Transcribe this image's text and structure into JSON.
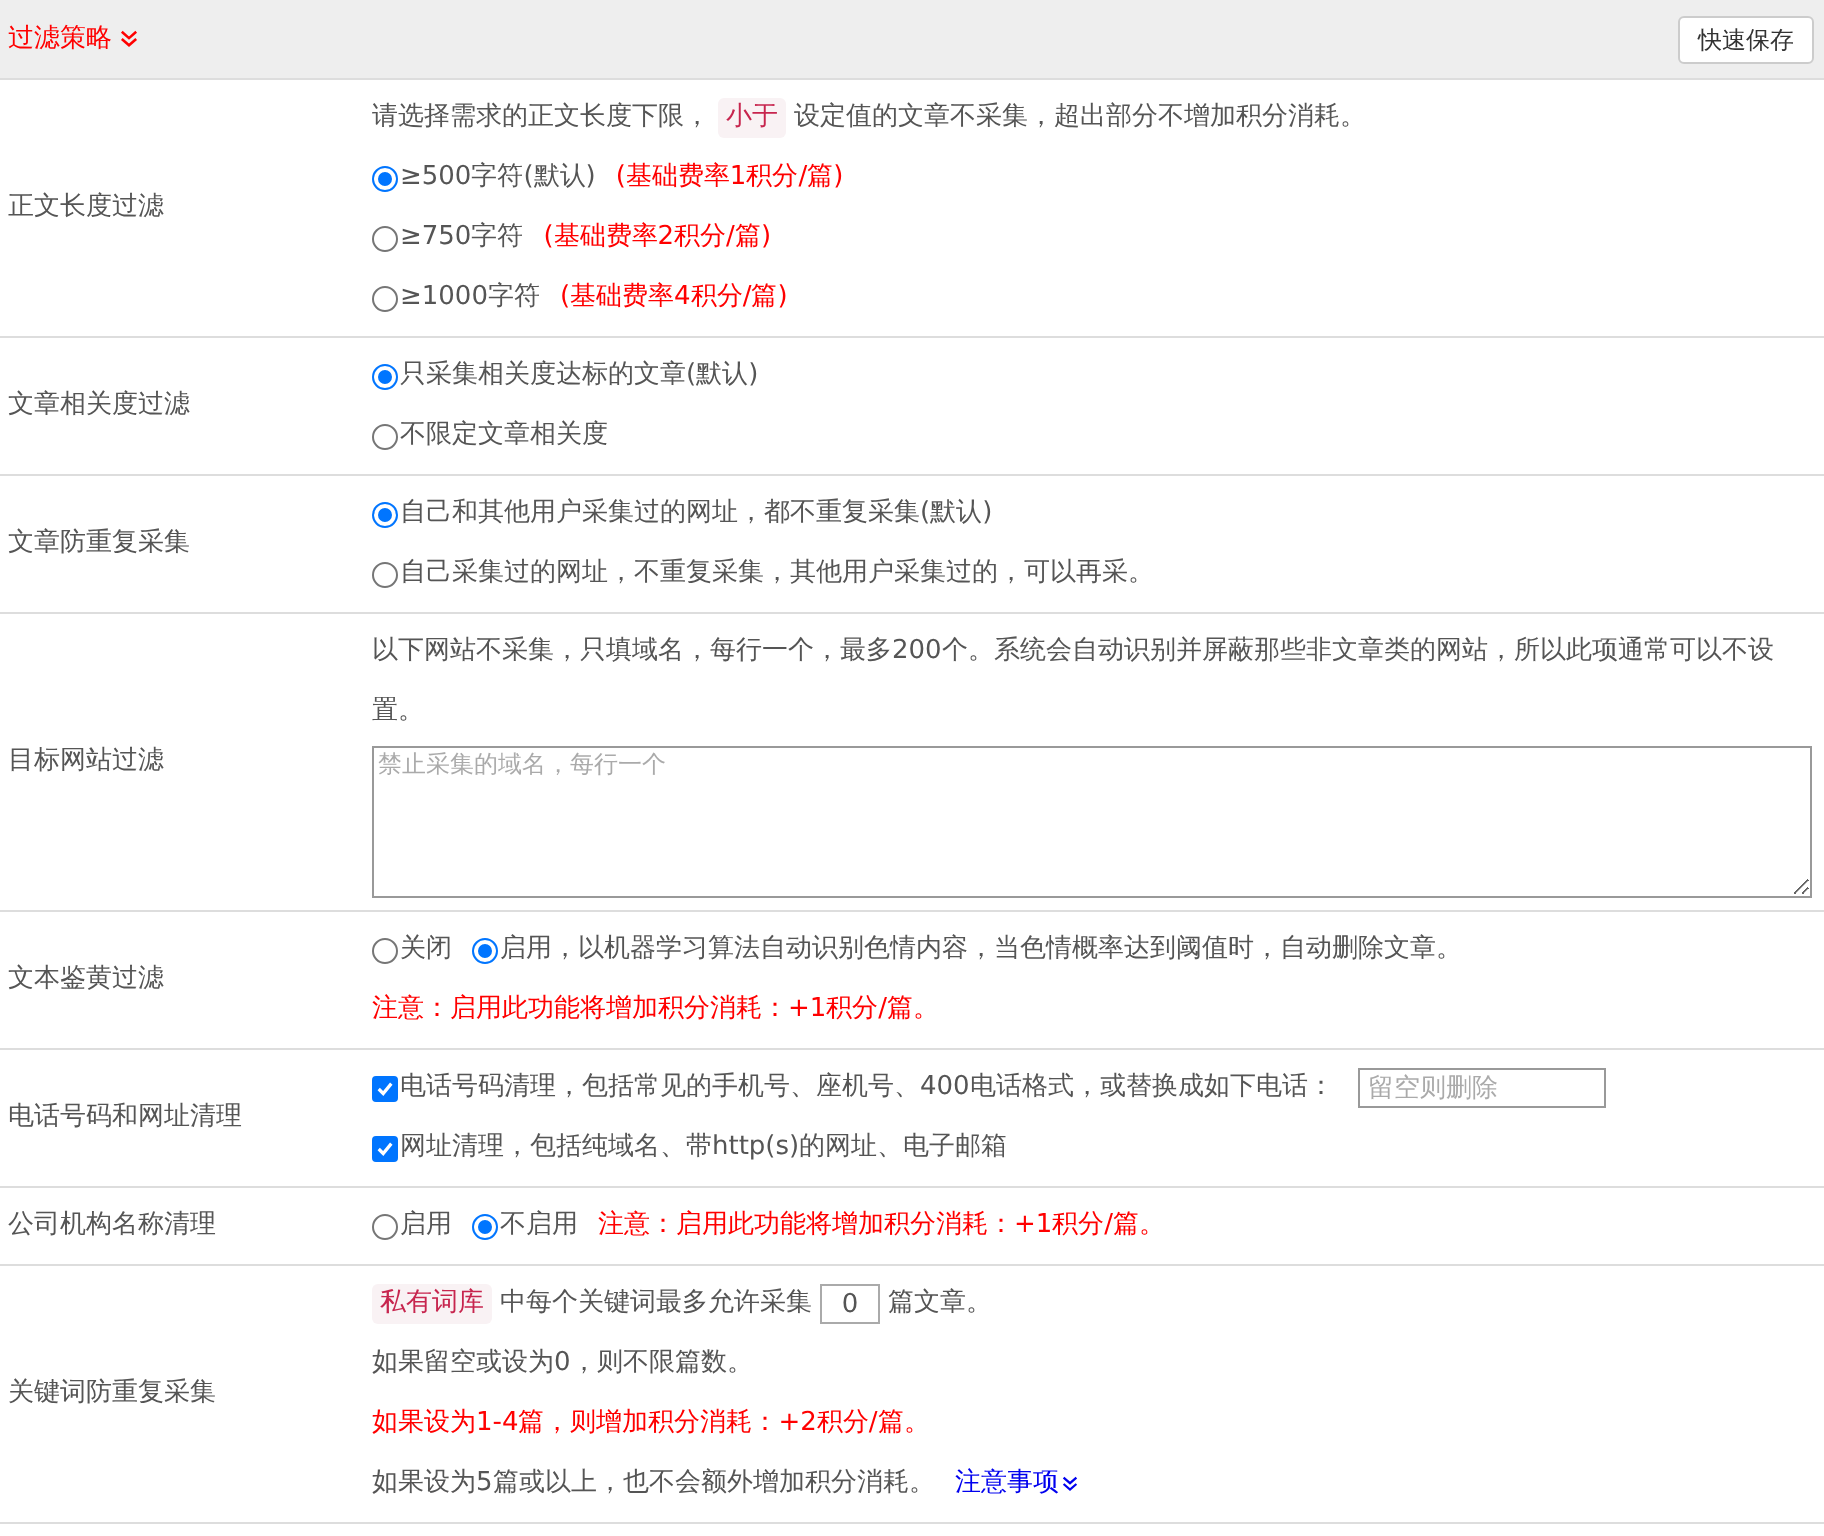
{
  "header": {
    "title": "过滤策略",
    "save_button": "快速保存"
  },
  "rows": [
    {
      "label": "正文长度过滤",
      "lines": [
        [
          {
            "kind": "text",
            "text": "请选择需求的正文长度下限，"
          },
          {
            "kind": "tag",
            "text": "小于"
          },
          {
            "kind": "text",
            "text": "设定值的文章不采集，超出部分不增加积分消耗。"
          }
        ],
        [
          {
            "kind": "radio",
            "selected": true,
            "label": "≥500字符(默认)"
          },
          {
            "kind": "warning",
            "text": "(基础费率1积分/篇)"
          }
        ],
        [
          {
            "kind": "radio",
            "selected": false,
            "label": "≥750字符"
          },
          {
            "kind": "warning",
            "text": "(基础费率2积分/篇)"
          }
        ],
        [
          {
            "kind": "radio",
            "selected": false,
            "label": "≥1000字符"
          },
          {
            "kind": "warning",
            "text": "(基础费率4积分/篇)"
          }
        ]
      ]
    },
    {
      "label": "文章相关度过滤",
      "lines": [
        [
          {
            "kind": "radio",
            "selected": true,
            "label": "只采集相关度达标的文章(默认)"
          }
        ],
        [
          {
            "kind": "radio",
            "selected": false,
            "label": "不限定文章相关度"
          }
        ]
      ]
    },
    {
      "label": "文章防重复采集",
      "lines": [
        [
          {
            "kind": "radio",
            "selected": true,
            "label": "自己和其他用户采集过的网址，都不重复采集(默认)"
          }
        ],
        [
          {
            "kind": "radio",
            "selected": false,
            "label": "自己采集过的网址，不重复采集，其他用户采集过的，可以再采。"
          }
        ]
      ]
    },
    {
      "label": "目标网站过滤",
      "lines": [
        [
          {
            "kind": "text",
            "text": "以下网站不采集，只填域名，每行一个，最多200个。系统会自动识别并屏蔽那些非文章类的网站，所以此项通常可以不设置。"
          }
        ],
        [
          {
            "kind": "textarea",
            "placeholder": "禁止采集的域名，每行一个"
          }
        ]
      ]
    },
    {
      "label": "文本鉴黄过滤",
      "lines": [
        [
          {
            "kind": "radio",
            "selected": false,
            "label": "关闭"
          },
          {
            "kind": "radio",
            "selected": true,
            "label": "启用，以机器学习算法自动识别色情内容，当色情概率达到阈值时，自动删除文章。"
          }
        ],
        [
          {
            "kind": "warning",
            "text": "注意：启用此功能将增加积分消耗：+1积分/篇。"
          }
        ]
      ]
    },
    {
      "label": "电话号码和网址清理",
      "lines": [
        [
          {
            "kind": "checkbox",
            "checked": true,
            "label": "电话号码清理，包括常见的手机号、座机号、400电话格式，或替换成如下电话："
          },
          {
            "kind": "input",
            "placeholder": "留空则删除"
          }
        ],
        [
          {
            "kind": "checkbox",
            "checked": true,
            "label": "网址清理，包括纯域名、带http(s)的网址、电子邮箱"
          }
        ]
      ]
    },
    {
      "label": "公司机构名称清理",
      "lines": [
        [
          {
            "kind": "radio",
            "selected": false,
            "label": "启用"
          },
          {
            "kind": "radio",
            "selected": true,
            "label": "不启用"
          },
          {
            "kind": "warning",
            "text": "注意：启用此功能将增加积分消耗：+1积分/篇。"
          }
        ]
      ]
    },
    {
      "label": "关键词防重复采集",
      "lines": [
        [
          {
            "kind": "tag",
            "text": "私有词库"
          },
          {
            "kind": "text",
            "text": "中每个关键词最多允许采集"
          },
          {
            "kind": "number",
            "value": "0"
          },
          {
            "kind": "text",
            "text": "篇文章。"
          }
        ],
        [
          {
            "kind": "text",
            "text": "如果留空或设为0，则不限篇数。"
          }
        ],
        [
          {
            "kind": "warning",
            "text": "如果设为1-4篇，则增加积分消耗：+2积分/篇。"
          }
        ],
        [
          {
            "kind": "text",
            "text": "如果设为5篇或以上，也不会额外增加积分消耗。"
          },
          {
            "kind": "link",
            "text": "注意事项"
          }
        ]
      ]
    }
  ]
}
